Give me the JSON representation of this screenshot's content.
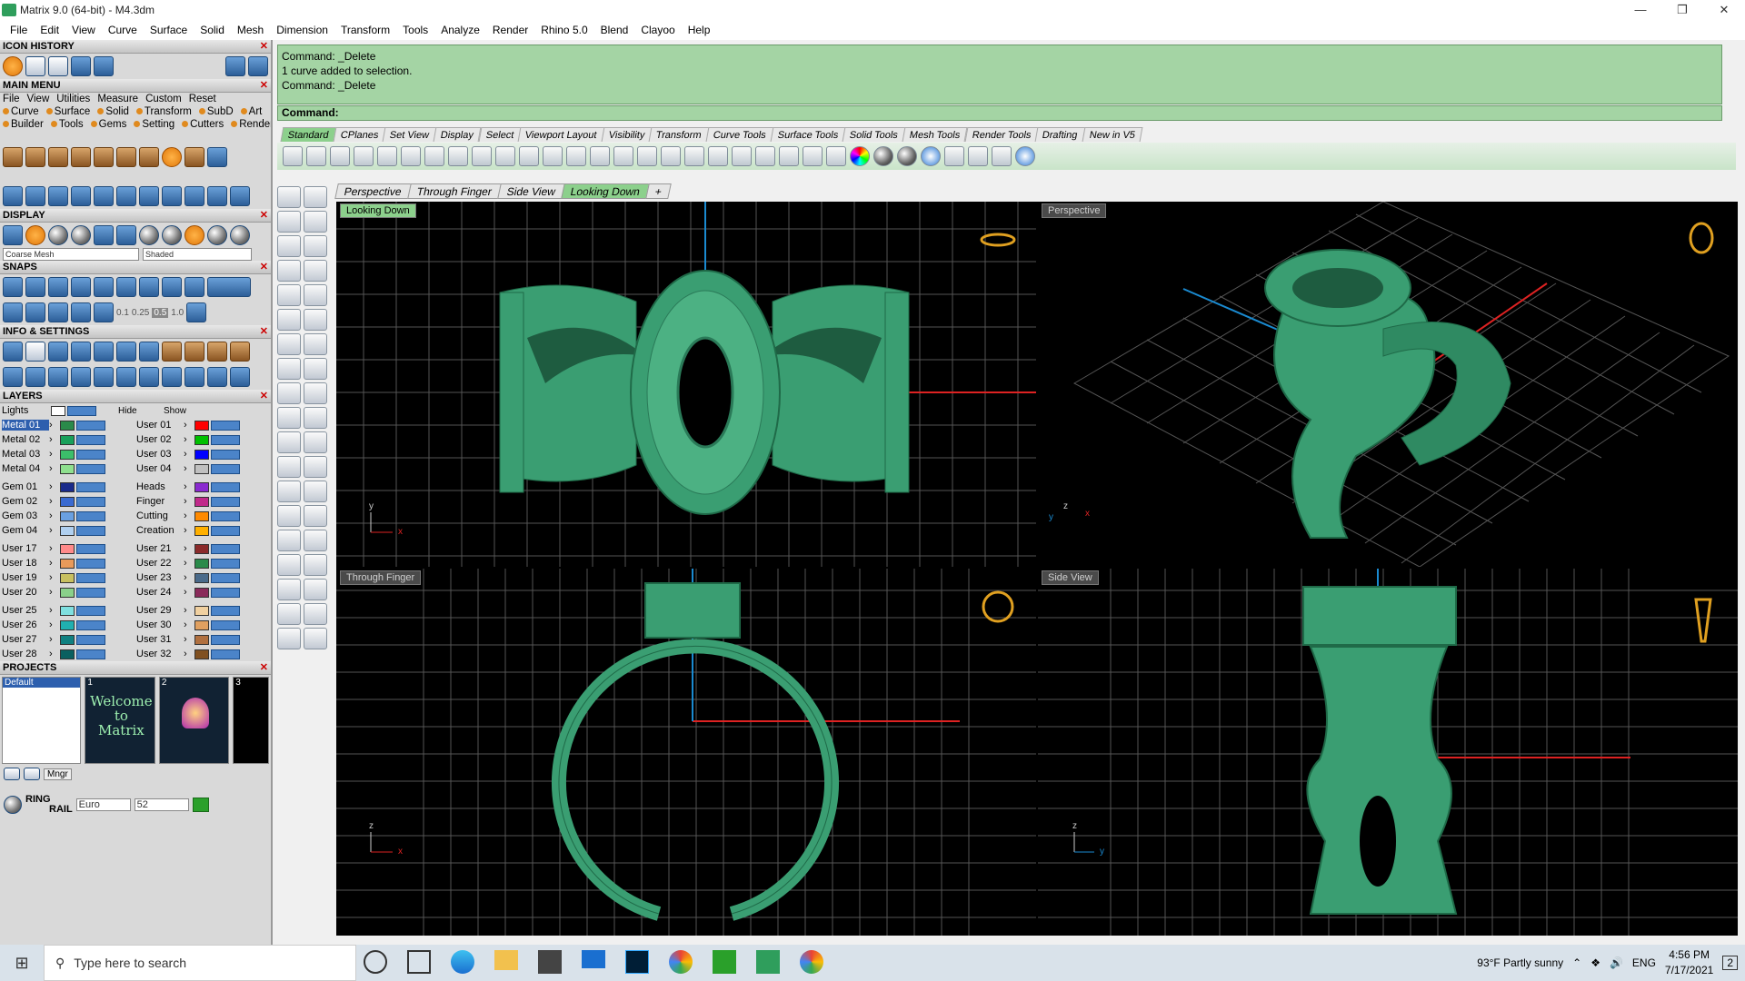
{
  "window": {
    "title": "Matrix 9.0 (64-bit) - M4.3dm"
  },
  "menubar": [
    "File",
    "Edit",
    "View",
    "Curve",
    "Surface",
    "Solid",
    "Mesh",
    "Dimension",
    "Transform",
    "Tools",
    "Analyze",
    "Render",
    "Rhino 5.0",
    "Blend",
    "Clayoo",
    "Help"
  ],
  "left": {
    "icon_history": "ICON HISTORY",
    "main_menu": "MAIN MENU",
    "main_menu_row1": [
      "File",
      "View",
      "Utilities",
      "Measure",
      "Custom",
      "Reset"
    ],
    "main_menu_row2": [
      "Curve",
      "Surface",
      "Solid",
      "Transform",
      "SubD",
      "Art"
    ],
    "main_menu_row3": [
      "Builder",
      "Tools",
      "Gems",
      "Setting",
      "Cutters",
      "Render"
    ],
    "display": "DISPLAY",
    "display_mesh": "Coarse Mesh",
    "display_mode": "Shaded",
    "snaps": "SNAPS",
    "snap_values": [
      "0.1",
      "0.25",
      "0.5",
      "1.0"
    ],
    "info": "INFO & SETTINGS",
    "layers": "LAYERS",
    "lights": "Lights",
    "hide": "Hide",
    "show": "Show",
    "layers_left": [
      {
        "name": "Metal 01",
        "color": "#2a8a4a",
        "selected": true
      },
      {
        "name": "Metal 02",
        "color": "#18a05a"
      },
      {
        "name": "Metal 03",
        "color": "#3bbf6a"
      },
      {
        "name": "Metal 04",
        "color": "#8fe08f"
      },
      {
        "name": "Gem 01",
        "color": "#1a2a8a"
      },
      {
        "name": "Gem 02",
        "color": "#3a6ad0"
      },
      {
        "name": "Gem 03",
        "color": "#6aa0e0"
      },
      {
        "name": "Gem 04",
        "color": "#b0d0f0"
      },
      {
        "name": "User 17",
        "color": "#ff8a8a"
      },
      {
        "name": "User 18",
        "color": "#e89a5a"
      },
      {
        "name": "User 19",
        "color": "#c8c060"
      },
      {
        "name": "User 20",
        "color": "#8ad08a"
      },
      {
        "name": "User 25",
        "color": "#7fe0e0"
      },
      {
        "name": "User 26",
        "color": "#20b0b0"
      },
      {
        "name": "User 27",
        "color": "#108080"
      },
      {
        "name": "User 28",
        "color": "#0a6060"
      }
    ],
    "layers_right": [
      {
        "name": "User 01",
        "color": "#ff0000"
      },
      {
        "name": "User 02",
        "color": "#00c000"
      },
      {
        "name": "User 03",
        "color": "#0000ff"
      },
      {
        "name": "User 04",
        "color": "#c0c0c0"
      },
      {
        "name": "Heads",
        "color": "#8a2ad0"
      },
      {
        "name": "Finger",
        "color": "#c02a8a"
      },
      {
        "name": "Cutting",
        "color": "#ff8a00"
      },
      {
        "name": "Creation",
        "color": "#ffb000"
      },
      {
        "name": "User 21",
        "color": "#8a2a2a"
      },
      {
        "name": "User 22",
        "color": "#2a8a4a"
      },
      {
        "name": "User 23",
        "color": "#4a6a8a"
      },
      {
        "name": "User 24",
        "color": "#8a2a5a"
      },
      {
        "name": "User 29",
        "color": "#f0d0a0"
      },
      {
        "name": "User 30",
        "color": "#e0a060"
      },
      {
        "name": "User 31",
        "color": "#b07040"
      },
      {
        "name": "User 32",
        "color": "#805020"
      }
    ],
    "projects": "PROJECTS",
    "project_default": "Default",
    "thumb_nums": [
      "1",
      "2",
      "3"
    ],
    "thumb_welcome": "Welcome to Matrix",
    "mngr": "Mngr",
    "ring_rail_1": "RING",
    "ring_rail_2": "RAIL",
    "ring_standard": "Euro",
    "ring_size": "52"
  },
  "command": {
    "history": [
      "Command: _Delete",
      "1 curve added to selection.",
      "Command: _Delete"
    ],
    "prompt": "Command:"
  },
  "toolbar_tabs": [
    "Standard",
    "CPlanes",
    "Set View",
    "Display",
    "Select",
    "Viewport Layout",
    "Visibility",
    "Transform",
    "Curve Tools",
    "Surface Tools",
    "Solid Tools",
    "Mesh Tools",
    "Render Tools",
    "Drafting",
    "New in V5"
  ],
  "viewport_tabs": [
    "Perspective",
    "Through Finger",
    "Side View",
    "Looking Down"
  ],
  "viewports": {
    "top_left": "Looking Down",
    "top_right": "Perspective",
    "bottom_left": "Through Finger",
    "bottom_right": "Side View"
  },
  "axis_labels": {
    "x": "x",
    "y": "y",
    "z": "z"
  },
  "taskbar": {
    "search_placeholder": "Type here to search",
    "weather": "93°F  Partly sunny",
    "lang": "ENG",
    "time": "4:56 PM",
    "date": "7/17/2021",
    "notif": "2"
  },
  "colors": {
    "ring": "#3a9e72",
    "command_bg": "#a4d4a4",
    "active_tab": "#8cd08c",
    "accent": "#2d5fae"
  }
}
